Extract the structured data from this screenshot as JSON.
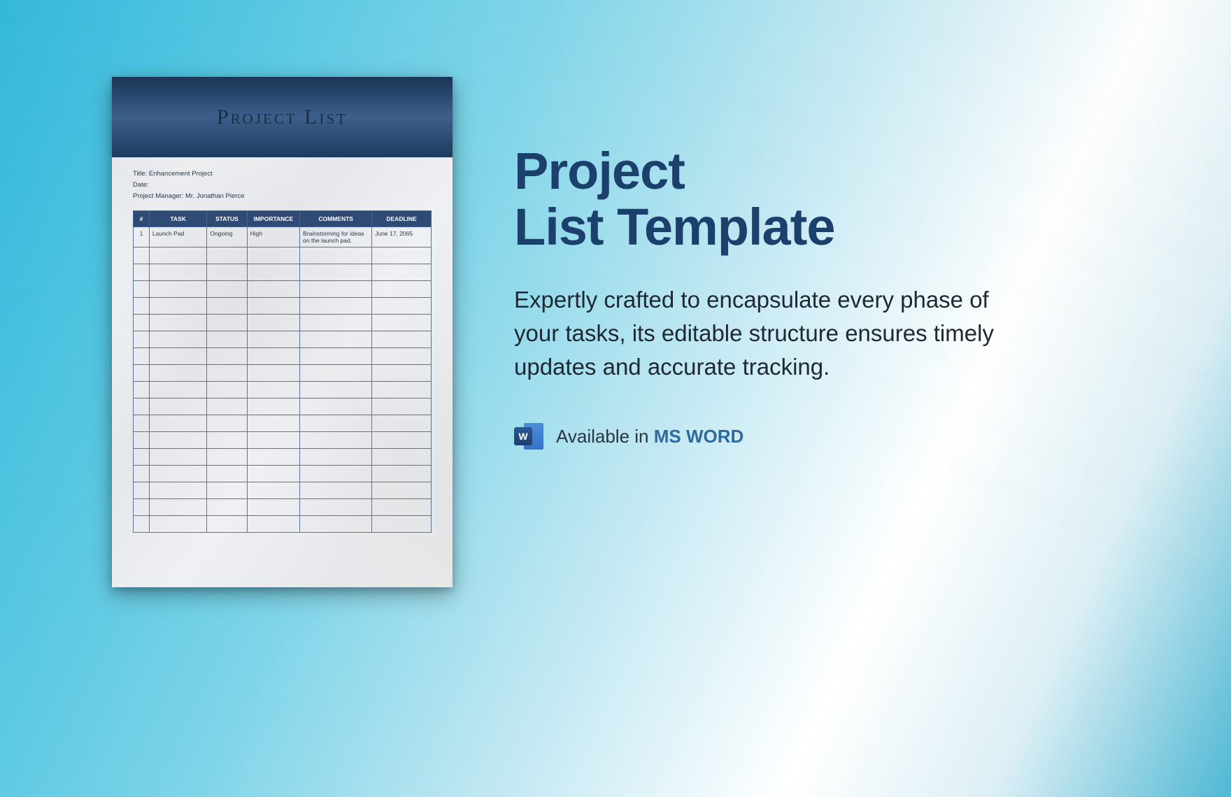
{
  "document": {
    "header_title": "Project List",
    "meta": {
      "title_label": "Title:",
      "title_value": "Enhancement Project",
      "date_label": "Date:",
      "date_value": "",
      "manager_label": "Project Manager:",
      "manager_value": "Mr. Jonathan Pierce"
    },
    "table": {
      "headers": {
        "num": "#",
        "task": "TASK",
        "status": "STATUS",
        "importance": "IMPORTANCE",
        "comments": "COMMENTS",
        "deadline": "DEADLINE"
      },
      "rows": [
        {
          "num": "1",
          "task": "Launch Pad",
          "status": "Ongoing",
          "importance": "High",
          "comments": "Brainstorming for ideas on the launch pad.",
          "deadline": "June 17, 2065"
        },
        {
          "num": "",
          "task": "",
          "status": "",
          "importance": "",
          "comments": "",
          "deadline": ""
        },
        {
          "num": "",
          "task": "",
          "status": "",
          "importance": "",
          "comments": "",
          "deadline": ""
        },
        {
          "num": "",
          "task": "",
          "status": "",
          "importance": "",
          "comments": "",
          "deadline": ""
        },
        {
          "num": "",
          "task": "",
          "status": "",
          "importance": "",
          "comments": "",
          "deadline": ""
        },
        {
          "num": "",
          "task": "",
          "status": "",
          "importance": "",
          "comments": "",
          "deadline": ""
        },
        {
          "num": "",
          "task": "",
          "status": "",
          "importance": "",
          "comments": "",
          "deadline": ""
        },
        {
          "num": "",
          "task": "",
          "status": "",
          "importance": "",
          "comments": "",
          "deadline": ""
        },
        {
          "num": "",
          "task": "",
          "status": "",
          "importance": "",
          "comments": "",
          "deadline": ""
        },
        {
          "num": "",
          "task": "",
          "status": "",
          "importance": "",
          "comments": "",
          "deadline": ""
        },
        {
          "num": "",
          "task": "",
          "status": "",
          "importance": "",
          "comments": "",
          "deadline": ""
        },
        {
          "num": "",
          "task": "",
          "status": "",
          "importance": "",
          "comments": "",
          "deadline": ""
        },
        {
          "num": "",
          "task": "",
          "status": "",
          "importance": "",
          "comments": "",
          "deadline": ""
        },
        {
          "num": "",
          "task": "",
          "status": "",
          "importance": "",
          "comments": "",
          "deadline": ""
        },
        {
          "num": "",
          "task": "",
          "status": "",
          "importance": "",
          "comments": "",
          "deadline": ""
        },
        {
          "num": "",
          "task": "",
          "status": "",
          "importance": "",
          "comments": "",
          "deadline": ""
        },
        {
          "num": "",
          "task": "",
          "status": "",
          "importance": "",
          "comments": "",
          "deadline": ""
        },
        {
          "num": "",
          "task": "",
          "status": "",
          "importance": "",
          "comments": "",
          "deadline": ""
        }
      ]
    }
  },
  "promo": {
    "title_line1": "Project",
    "title_line2": "List Template",
    "description": "Expertly crafted to encapsulate every phase of your tasks, its editable structure ensures timely updates and accurate tracking.",
    "availability_prefix": "Available in",
    "availability_format": "MS WORD",
    "word_icon_letter": "W"
  }
}
